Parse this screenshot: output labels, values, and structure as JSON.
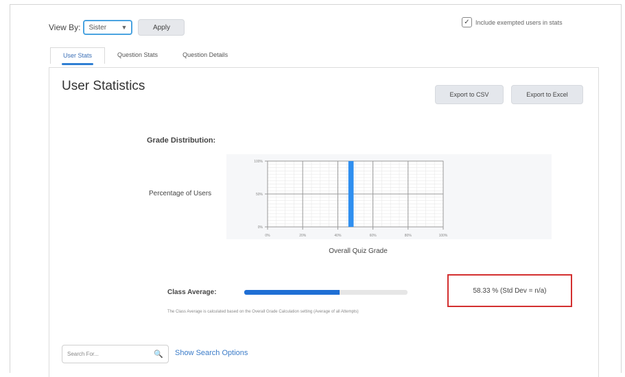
{
  "toolbar": {
    "view_by_label": "View By:",
    "view_by_value": "Sister",
    "apply_label": "Apply",
    "include_label": "Include exempted users in stats",
    "include_checked": true
  },
  "tabs": [
    {
      "label": "User Stats",
      "active": true
    },
    {
      "label": "Question Stats",
      "active": false
    },
    {
      "label": "Question Details",
      "active": false
    }
  ],
  "page": {
    "title": "User Statistics",
    "export_csv": "Export to CSV",
    "export_excel": "Export to Excel"
  },
  "chart_data": {
    "type": "bar",
    "title": "Grade Distribution:",
    "ylabel": "Percentage of Users",
    "xlabel": "Overall Quiz Grade",
    "x_ticks": [
      "0%",
      "20%",
      "40%",
      "60%",
      "80%",
      "100%"
    ],
    "y_ticks": [
      "100%",
      "50%",
      "0%"
    ],
    "xlim": [
      0,
      100
    ],
    "ylim": [
      0,
      100
    ],
    "bars": [
      {
        "x": 47.5,
        "width": 3,
        "value": 100
      }
    ],
    "bar_color": "#2f8ff0",
    "grid": true
  },
  "class_average": {
    "label": "Class Average:",
    "percent": 58.33,
    "value_text": "58.33 % (Std Dev = n/a)",
    "note": "The Class Average is calculated based on the Overall Grade Calculation setting (Average of all Attempts)",
    "highlight_color": "#d32f2f"
  },
  "search": {
    "placeholder": "Search For...",
    "show_options": "Show Search Options"
  }
}
